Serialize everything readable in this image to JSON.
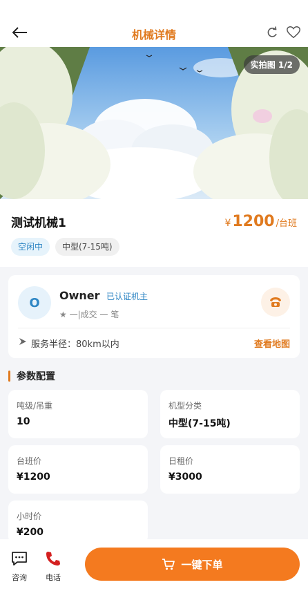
{
  "header": {
    "title": "机械详情"
  },
  "icons": {
    "back": "arrow-left-icon",
    "refresh": "refresh-icon",
    "favorite": "heart-icon",
    "phone": "phone-icon",
    "chat": "chat-icon",
    "cart": "cart-icon",
    "radius": "arrow-icon"
  },
  "gallery": {
    "badge": "实拍图 1/2",
    "current": 1,
    "total": 2
  },
  "machine": {
    "name": "测试机械1",
    "price_symbol": "¥",
    "price": "1200",
    "price_unit": "/台班",
    "status_tag": "空闲中",
    "size_tag": "中型(7-15吨)"
  },
  "owner": {
    "avatar_letter": "O",
    "name": "Owner",
    "verified": "已认证机主",
    "stats": "★ 一|成交 一 笔",
    "radius_text": "服务半径：80km以内",
    "map_link": "查看地图"
  },
  "specs": {
    "title": "参数配置",
    "items": [
      {
        "label": "吨级/吊重",
        "value": "10"
      },
      {
        "label": "机型分类",
        "value": "中型(7-15吨)"
      },
      {
        "label": "台班价",
        "value": "¥1200"
      },
      {
        "label": "日租价",
        "value": "¥3000"
      },
      {
        "label": "小时价",
        "value": "¥200"
      }
    ]
  },
  "bottom": {
    "consult": "咨询",
    "call": "电话",
    "order": "一键下单"
  },
  "colors": {
    "accent": "#f47a1f",
    "title": "#e07a1f",
    "blue": "#2a83c3"
  }
}
